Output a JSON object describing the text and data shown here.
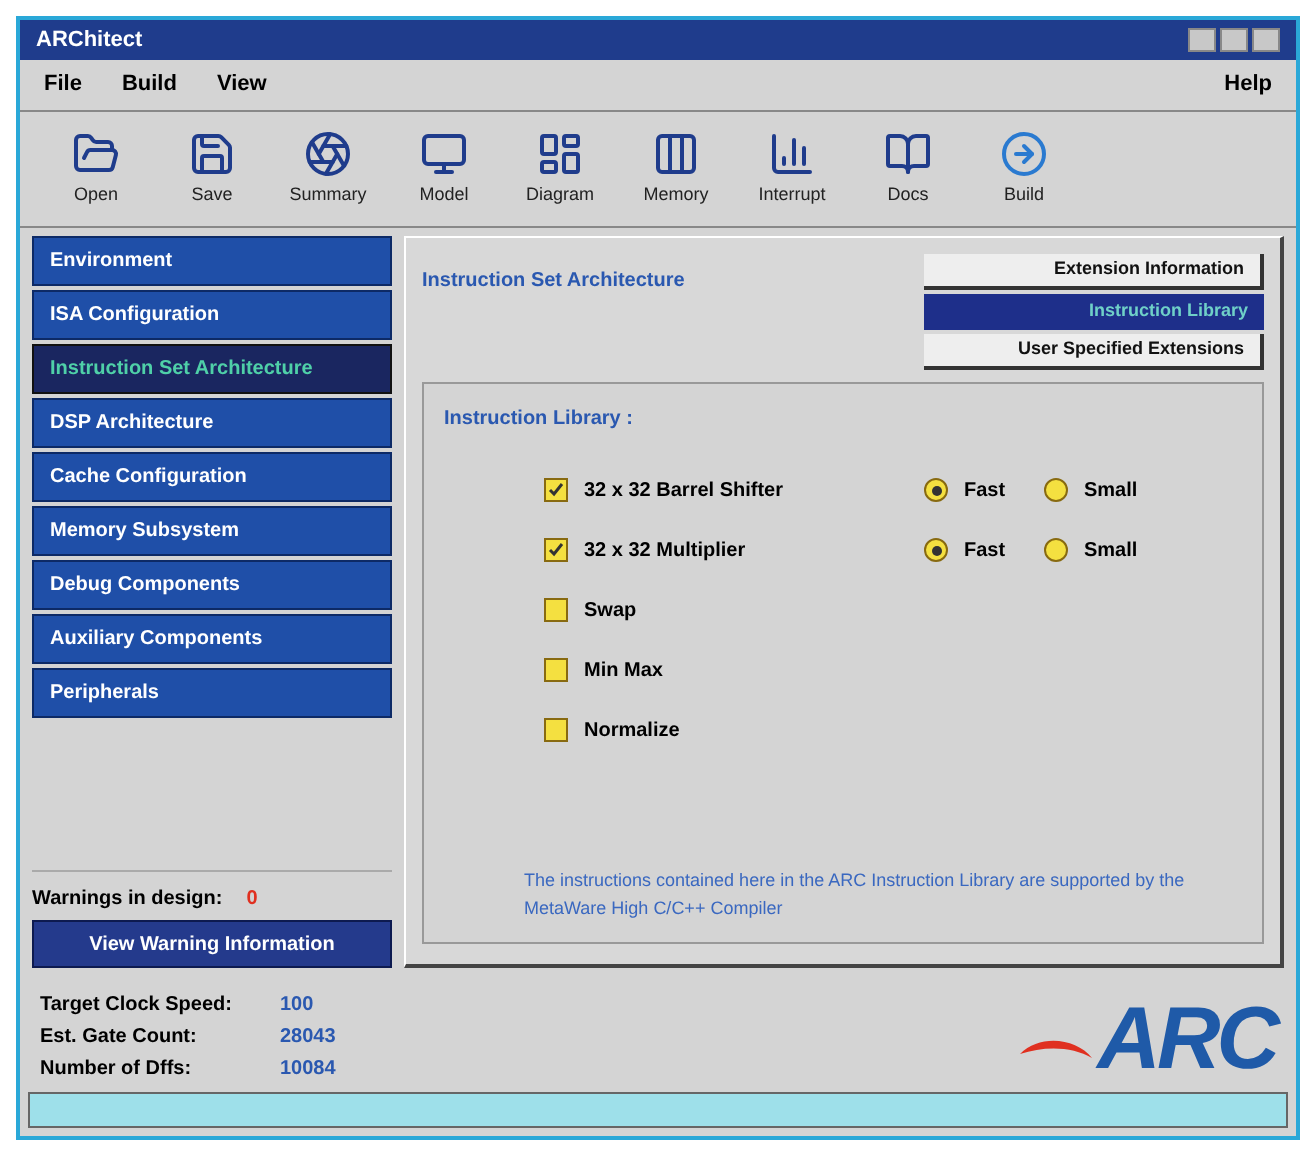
{
  "window": {
    "title": "ARChitect"
  },
  "menu": {
    "left": [
      "File",
      "Build",
      "View"
    ],
    "right": "Help"
  },
  "toolbar": [
    "Open",
    "Save",
    "Summary",
    "Model",
    "Diagram",
    "Memory",
    "Interrupt",
    "Docs",
    "Build"
  ],
  "sidebar": {
    "items": [
      {
        "label": "Environment",
        "selected": false
      },
      {
        "label": "ISA Configuration",
        "selected": false
      },
      {
        "label": "Instruction Set Architecture",
        "selected": true
      },
      {
        "label": "DSP Architecture",
        "selected": false
      },
      {
        "label": "Cache Configuration",
        "selected": false
      },
      {
        "label": "Memory Subsystem",
        "selected": false
      },
      {
        "label": "Debug Components",
        "selected": false
      },
      {
        "label": "Auxiliary Components",
        "selected": false
      },
      {
        "label": "Peripherals",
        "selected": false
      }
    ],
    "warnings_label": "Warnings in design:",
    "warnings_count": "0",
    "warnings_button": "View Warning Information"
  },
  "panel": {
    "title": "Instruction Set Architecture",
    "tabs": [
      {
        "label": "Extension Information",
        "selected": false
      },
      {
        "label": "Instruction Library",
        "selected": true
      },
      {
        "label": "User Specified Extensions",
        "selected": false
      }
    ],
    "group_title": "Instruction Library :",
    "options": [
      {
        "label": "32 x 32 Barrel Shifter",
        "checked": true,
        "modes": [
          {
            "label": "Fast",
            "selected": true
          },
          {
            "label": "Small",
            "selected": false
          }
        ]
      },
      {
        "label": "32 x 32 Multiplier",
        "checked": true,
        "modes": [
          {
            "label": "Fast",
            "selected": true
          },
          {
            "label": "Small",
            "selected": false
          }
        ]
      },
      {
        "label": "Swap",
        "checked": false
      },
      {
        "label": "Min Max",
        "checked": false
      },
      {
        "label": "Normalize",
        "checked": false
      }
    ],
    "note": "The instructions contained here in the ARC Instruction Library are supported by the MetaWare High C/C++ Compiler"
  },
  "stats": [
    {
      "label": "Target Clock Speed:",
      "value": "100"
    },
    {
      "label": "Est. Gate Count:",
      "value": "28043"
    },
    {
      "label": "Number of Dffs:",
      "value": "10084"
    }
  ],
  "logo": "ARC"
}
